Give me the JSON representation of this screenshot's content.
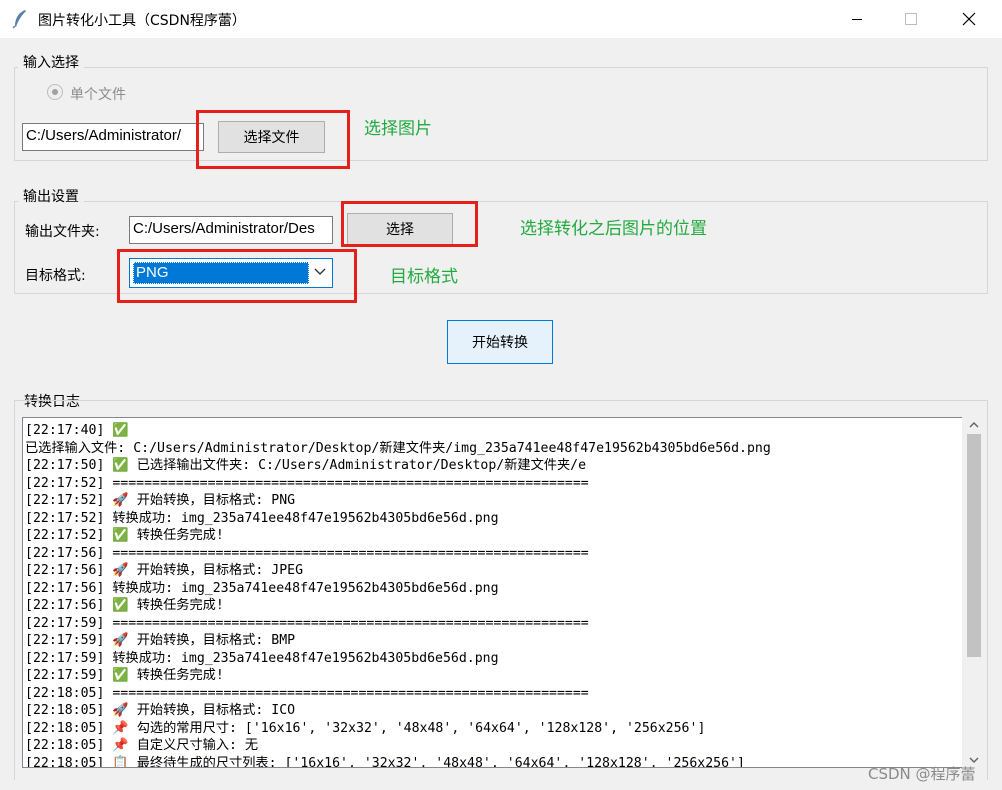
{
  "window": {
    "title": "图片转化小工具（CSDN程序蕾）",
    "icon": "feather-icon",
    "controls": [
      "minimize-icon",
      "maximize-icon",
      "close-icon"
    ]
  },
  "input_group": {
    "title": "输入选择",
    "radio_label": "单个文件",
    "path_value": "C:/Users/Administrator/",
    "button_label": "选择文件"
  },
  "output_group": {
    "title": "输出设置",
    "folder_label": "输出文件夹:",
    "folder_value": "C:/Users/Administrator/Des",
    "choose_button": "选择",
    "format_label": "目标格式:",
    "format_value": "PNG"
  },
  "start_button": "开始转换",
  "log": {
    "title": "转换日志",
    "lines": [
      "[22:17:40] ✅",
      "已选择输入文件: C:/Users/Administrator/Desktop/新建文件夹/img_235a741ee48f47e19562b4305bd6e56d.png",
      "[22:17:50] ✅ 已选择输出文件夹: C:/Users/Administrator/Desktop/新建文件夹/e",
      "[22:17:52] ============================================================",
      "[22:17:52] 🚀 开始转换，目标格式: PNG",
      "[22:17:52] 转换成功: img_235a741ee48f47e19562b4305bd6e56d.png",
      "[22:17:52] ✅ 转换任务完成!",
      "[22:17:56] ============================================================",
      "[22:17:56] 🚀 开始转换，目标格式: JPEG",
      "[22:17:56] 转换成功: img_235a741ee48f47e19562b4305bd6e56d.png",
      "[22:17:56] ✅ 转换任务完成!",
      "[22:17:59] ============================================================",
      "[22:17:59] 🚀 开始转换，目标格式: BMP",
      "[22:17:59] 转换成功: img_235a741ee48f47e19562b4305bd6e56d.png",
      "[22:17:59] ✅ 转换任务完成!",
      "[22:18:05] ============================================================",
      "[22:18:05] 🚀 开始转换，目标格式: ICO",
      "[22:18:05] 📌 勾选的常用尺寸: ['16x16', '32x32', '48x48', '64x64', '128x128', '256x256']",
      "[22:18:05] 📌 自定义尺寸输入: 无",
      "[22:18:05] 📋 最终待生成的尺寸列表: ['16x16', '32x32', '48x48', '64x64', '128x128', '256x256']"
    ]
  },
  "annotations": {
    "choose_image": "选择图片",
    "output_location": "选择转化之后图片的位置",
    "target_format": "目标格式",
    "color": "#22aa3f",
    "box_color": "#e5201b"
  },
  "watermark": "CSDN @程序蕾"
}
